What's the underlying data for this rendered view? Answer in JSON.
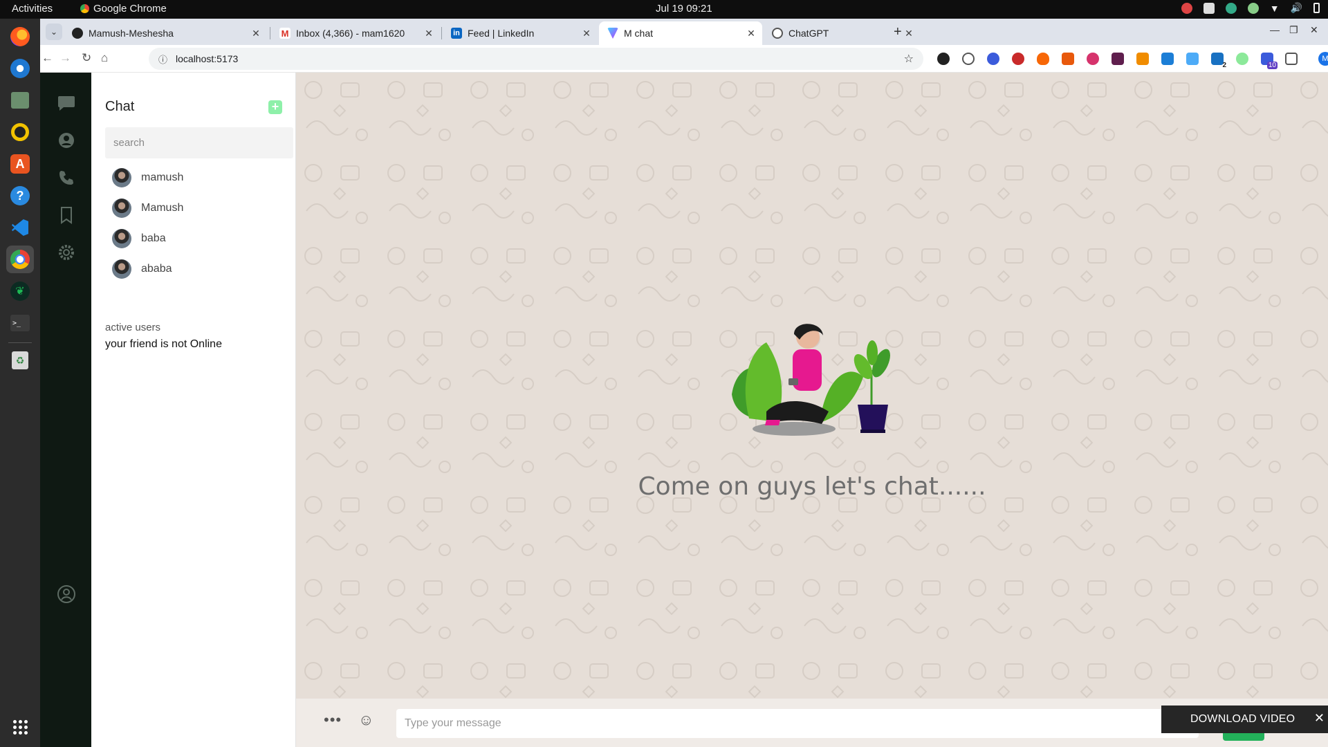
{
  "system": {
    "activities": "Activities",
    "app_name": "Google Chrome",
    "clock": "Jul 19  09:21"
  },
  "browser": {
    "tabs": [
      {
        "title": "Mamush-Meshesha",
        "icon": "github-icon"
      },
      {
        "title": "Inbox (4,366) - mam1620",
        "icon": "gmail-icon"
      },
      {
        "title": "Feed | LinkedIn",
        "icon": "linkedin-icon"
      },
      {
        "title": "M chat",
        "icon": "vite-icon",
        "active": true
      },
      {
        "title": "ChatGPT",
        "icon": "openai-icon"
      }
    ],
    "url": "localhost:5173",
    "profile_initial": "M",
    "ext_badges": {
      "a": "2",
      "b": "10"
    }
  },
  "sidebar": {
    "title": "Chat",
    "search_placeholder": "search",
    "users": [
      {
        "name": "mamush",
        "online": true
      },
      {
        "name": "Mamush",
        "online": true
      },
      {
        "name": "baba",
        "online": true
      },
      {
        "name": "ababa",
        "online": true
      }
    ],
    "active_users_label": "active users",
    "status": "your friend is not Online"
  },
  "main": {
    "welcome": "Come on guys let's chat......",
    "message_placeholder": "Type your message",
    "download_video": "DOWNLOAD VIDEO"
  },
  "colors": {
    "rail_bg": "#0f1913",
    "online_dot": "#17a54a",
    "accent_green": "#23b15a",
    "chat_bg": "#e6ded7"
  }
}
